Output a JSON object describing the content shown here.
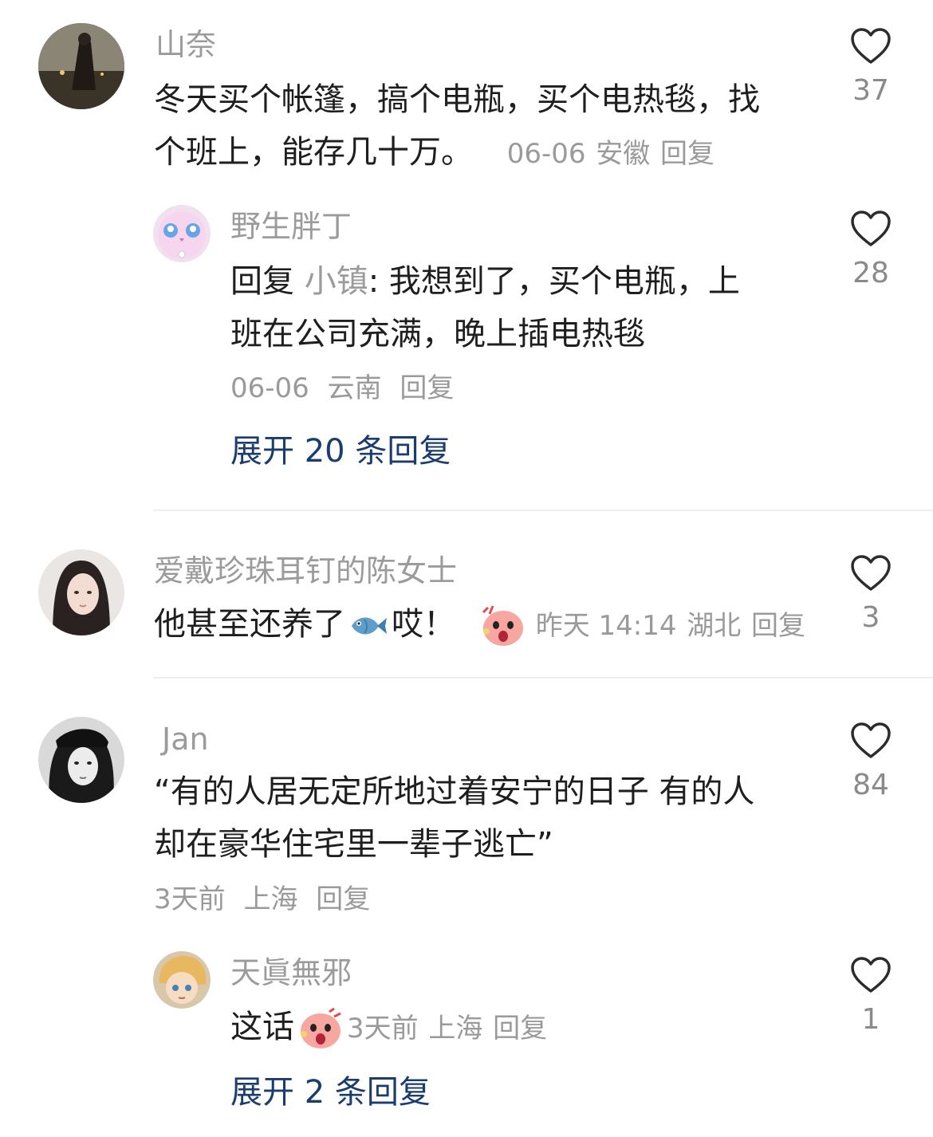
{
  "comments": [
    {
      "name": "山奈",
      "text_lines": [
        "冬天买个帐篷，搞个电瓶，买个电热毯，找",
        "个班上，能存几十万。"
      ],
      "date": "06-06",
      "location": "安徽",
      "reply_label": "回复",
      "likes": "37",
      "replies": [
        {
          "name": "野生胖丁",
          "reply_prefix": "回复",
          "reply_to": "小镇",
          "text_lines": [
            ": 我想到了，买个电瓶，上",
            "班在公司充满，晚上插电热毯"
          ],
          "date": "06-06",
          "location": "云南",
          "reply_label": "回复",
          "likes": "28"
        }
      ],
      "expand_label": "展开 20 条回复"
    },
    {
      "name": "爱戴珍珠耳钉的陈女士",
      "text_before": "他甚至还养了",
      "text_after": "哎！",
      "date": "昨天 14:14",
      "location": "湖北",
      "reply_label": "回复",
      "likes": "3"
    },
    {
      "name": "Jan",
      "text_lines": [
        "“有的人居无定所地过着安宁的日子 有的人",
        "却在豪华住宅里一辈子逃亡”"
      ],
      "date": "3天前",
      "location": "上海",
      "reply_label": "回复",
      "likes": "84",
      "replies": [
        {
          "name": "天眞無邪",
          "text": "这话",
          "date": "3天前",
          "location": "上海",
          "reply_label": "回复",
          "likes": "1"
        }
      ],
      "expand_label": "展开 2 条回复"
    }
  ],
  "icons": {
    "like": "heart-outline-icon",
    "fish": "fish-emoji-icon",
    "shock": "shocked-face-emoji-icon"
  },
  "colors": {
    "name": "#9b9b9b",
    "text": "#1e1e1e",
    "meta": "#9a9a9a",
    "expand_link": "#1b3d6e"
  }
}
